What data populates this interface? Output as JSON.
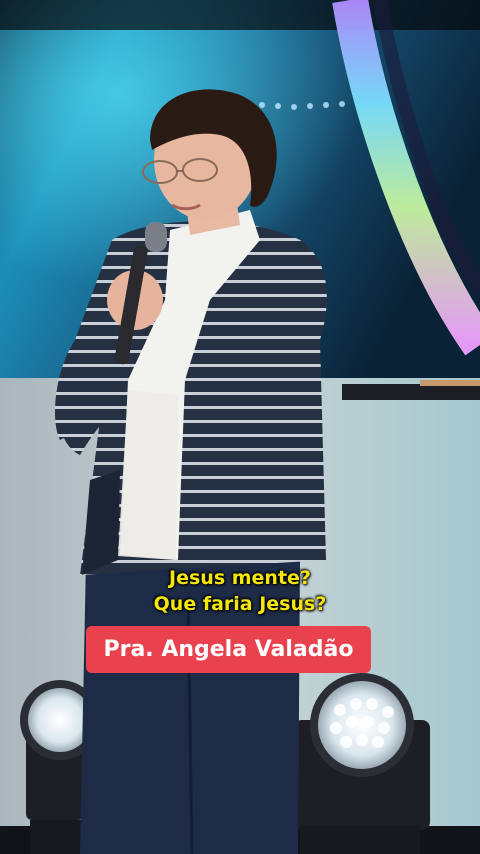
{
  "captions": {
    "line1": "Jesus mente?",
    "line2": "Que faria Jesus?"
  },
  "name_tag": {
    "label": "Pra. Angela Valadão"
  },
  "colors": {
    "caption": "#f4e60a",
    "name_tag_bg": "#e9424e",
    "name_tag_text": "#ffffff"
  }
}
